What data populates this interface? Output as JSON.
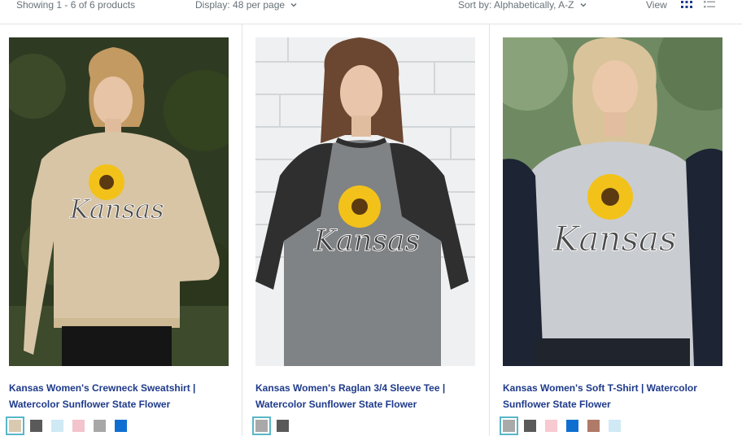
{
  "toolbar": {
    "count_text": "Showing 1 - 6 of 6 products",
    "display_text": "Display: 48 per page",
    "sort_text": "Sort by: Alphabetically, A-Z",
    "view_label": "View"
  },
  "products": [
    {
      "title_line1": "Kansas Women's Crewneck Sweatshirt |",
      "title_line2": "Watercolor Sunflower State Flower",
      "swatches": [
        "#d9c9b0",
        "#5a5a5a",
        "#cfe9f5",
        "#f3c4cc",
        "#a7a7a7",
        "#0f6fd1"
      ]
    },
    {
      "title_line1": "Kansas Women's Raglan 3/4 Sleeve Tee |",
      "title_line2": "Watercolor Sunflower State Flower",
      "swatches": [
        "#a9a9a9",
        "#5a5a5a"
      ]
    },
    {
      "title_line1": "Kansas Women's Soft T-Shirt | Watercolor",
      "title_line2": "Sunflower State Flower",
      "swatches": [
        "#a9a9a9",
        "#5a5a5a",
        "#f7c9d0",
        "#0f6fd1",
        "#b07a68",
        "#cfe9f5"
      ]
    }
  ],
  "print_text": "Kansas",
  "colors": {
    "title_blue": "#1e3a8a",
    "muted": "#677279",
    "selected_ring": "#5ab6c7",
    "active_view": "#1e3a8a"
  }
}
